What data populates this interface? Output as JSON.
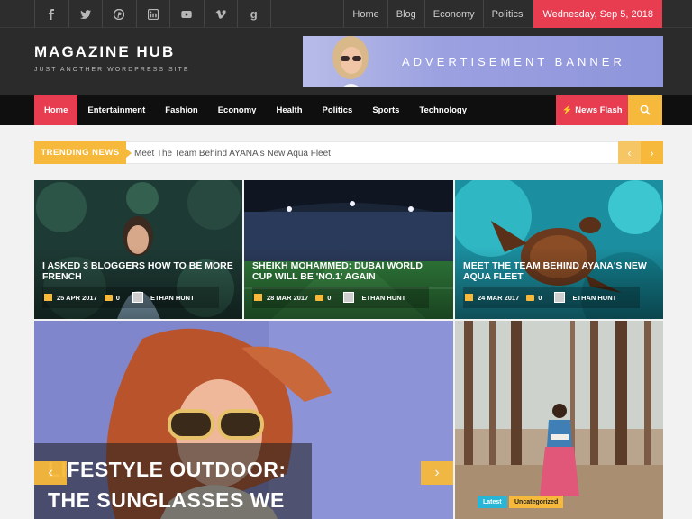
{
  "social_icons": [
    "facebook-icon",
    "twitter-icon",
    "pinterest-icon",
    "linkedin-icon",
    "youtube-icon",
    "vimeo-icon",
    "google-plus-icon"
  ],
  "top_nav": {
    "links": [
      "Home",
      "Blog",
      "Economy",
      "Politics"
    ],
    "date": "Wednesday, Sep 5, 2018"
  },
  "site": {
    "title": "MAGAZINE HUB",
    "tagline": "JUST ANOTHER WORDPRESS SITE"
  },
  "ad_banner": {
    "text": "ADVERTISEMENT BANNER"
  },
  "main_nav": {
    "items": [
      "Home",
      "Entertainment",
      "Fashion",
      "Economy",
      "Health",
      "Politics",
      "Sports",
      "Technology"
    ],
    "news_flash": "News Flash"
  },
  "trending": {
    "label": "TRENDING NEWS",
    "headline": "Meet The Team Behind AYANA's New Aqua Fleet"
  },
  "cards": [
    {
      "title": "I ASKED 3 BLOGGERS HOW TO BE MORE FRENCH",
      "date": "25 APR 2017",
      "comments": "0",
      "author": "ETHAN HUNT"
    },
    {
      "title": "SHEIKH MOHAMMED: DUBAI WORLD CUP WILL BE 'NO.1' AGAIN",
      "date": "28 MAR 2017",
      "comments": "0",
      "author": "ETHAN HUNT"
    },
    {
      "title": "MEET THE TEAM BEHIND AYANA'S NEW AQUA FLEET",
      "date": "24 MAR 2017",
      "comments": "0",
      "author": "ETHAN HUNT"
    }
  ],
  "featured": {
    "title_line1": "LIFESTYLE OUTDOOR:",
    "title_line2": "THE SUNGLASSES WE"
  },
  "side_post": {
    "badge_latest": "Latest",
    "badge_category": "Uncategorized"
  },
  "colors": {
    "accent_red": "#e83d51",
    "accent_yellow": "#f6b93b",
    "dark_bg": "#2b2b2b",
    "nav_bg": "#0f0f0f",
    "latest_badge": "#29b6d6"
  }
}
